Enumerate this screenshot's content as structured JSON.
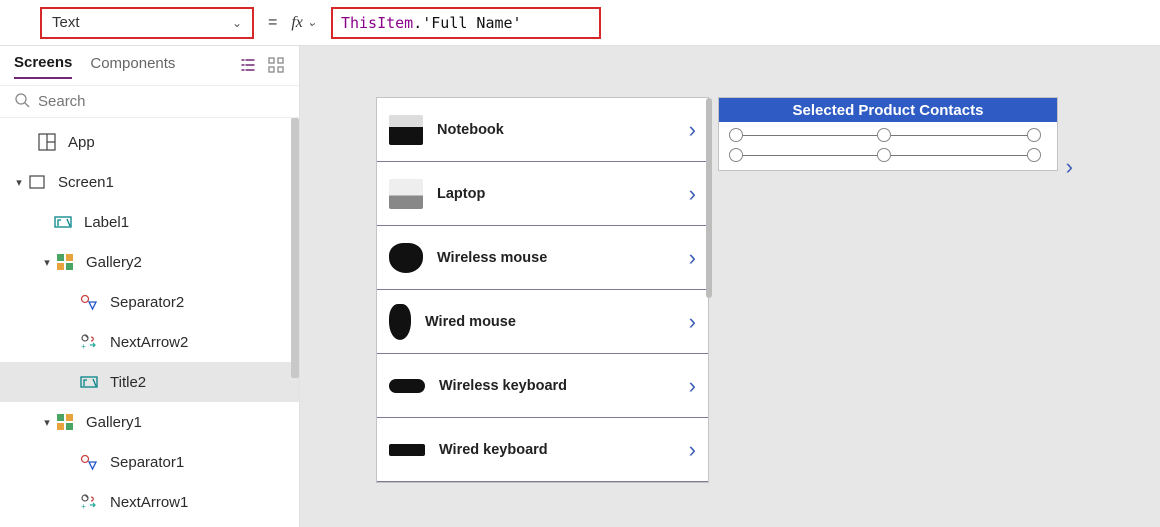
{
  "formula_bar": {
    "property": "Text",
    "fx_label": "fx",
    "formula_obj": "ThisItem",
    "formula_rest": ".'Full Name'"
  },
  "sidebar": {
    "tabs": {
      "screens": "Screens",
      "components": "Components"
    },
    "search_placeholder": "Search",
    "tree": [
      {
        "label": "App",
        "type": "app"
      },
      {
        "label": "Screen1",
        "type": "screen"
      },
      {
        "label": "Label1",
        "type": "label"
      },
      {
        "label": "Gallery2",
        "type": "gallery"
      },
      {
        "label": "Separator2",
        "type": "separator"
      },
      {
        "label": "NextArrow2",
        "type": "nextarrow"
      },
      {
        "label": "Title2",
        "type": "title"
      },
      {
        "label": "Gallery1",
        "type": "gallery"
      },
      {
        "label": "Separator1",
        "type": "separator"
      },
      {
        "label": "NextArrow1",
        "type": "nextarrow"
      }
    ]
  },
  "canvas": {
    "products": [
      {
        "label": "Notebook"
      },
      {
        "label": "Laptop"
      },
      {
        "label": "Wireless mouse"
      },
      {
        "label": "Wired mouse"
      },
      {
        "label": "Wireless keyboard"
      },
      {
        "label": "Wired keyboard"
      }
    ],
    "right_header": "Selected Product Contacts"
  }
}
